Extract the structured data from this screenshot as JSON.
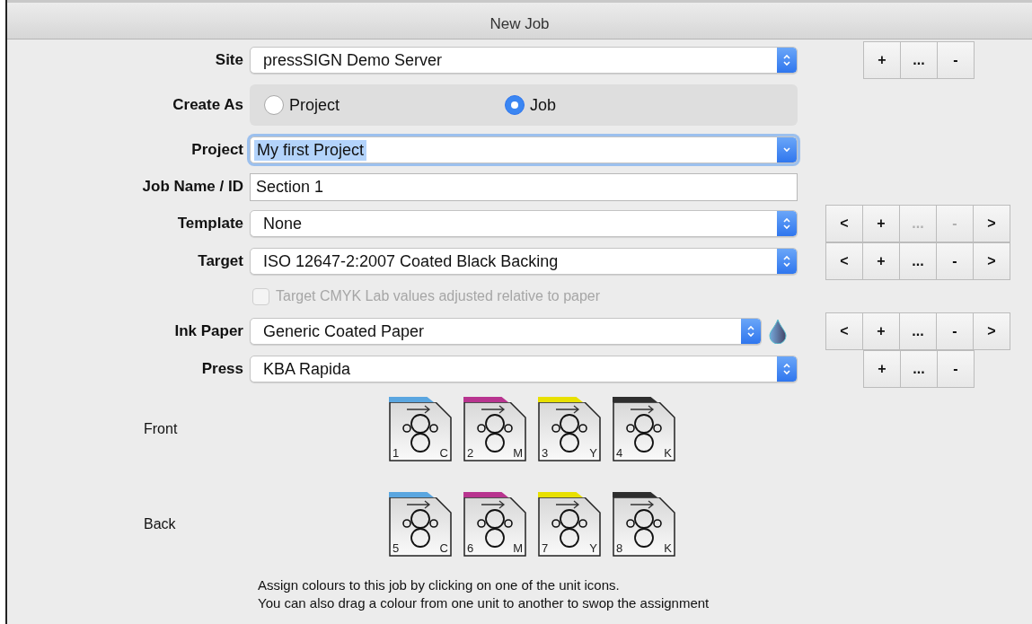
{
  "window": {
    "title": "New Job"
  },
  "form": [
    {
      "kind": "popup",
      "label": "Site",
      "value": "pressSIGN Demo Server",
      "buttons_inset": true,
      "buttons": [
        {
          "label": "+",
          "disabled": false
        },
        {
          "label": "...",
          "disabled": false
        },
        {
          "label": "-",
          "disabled": false
        }
      ]
    },
    {
      "kind": "radio",
      "label": "Create As",
      "options": [
        {
          "label": "Project",
          "selected": false
        },
        {
          "label": "Job",
          "selected": true
        }
      ]
    },
    {
      "kind": "combo",
      "label": "Project",
      "value": "My first Project",
      "focused": true
    },
    {
      "kind": "text",
      "label": "Job Name / ID",
      "value": "Section 1"
    },
    {
      "kind": "popup",
      "label": "Template",
      "value": "None",
      "buttons": [
        {
          "label": "<",
          "disabled": false
        },
        {
          "label": "+",
          "disabled": false
        },
        {
          "label": "...",
          "disabled": true
        },
        {
          "label": "-",
          "disabled": true
        },
        {
          "label": ">",
          "disabled": false
        }
      ]
    },
    {
      "kind": "popup",
      "label": "Target",
      "value": "ISO 12647-2:2007 Coated Black Backing",
      "buttons": [
        {
          "label": "<",
          "disabled": false
        },
        {
          "label": "+",
          "disabled": false
        },
        {
          "label": "...",
          "disabled": false
        },
        {
          "label": "-",
          "disabled": false
        },
        {
          "label": ">",
          "disabled": false
        }
      ]
    },
    {
      "kind": "checkbox",
      "label": "Target CMYK Lab values adjusted relative to paper",
      "checked": false,
      "disabled": true
    },
    {
      "kind": "popup",
      "label": "Ink Paper",
      "value": "Generic Coated Paper",
      "ink_drop": true,
      "buttons": [
        {
          "label": "<",
          "disabled": false
        },
        {
          "label": "+",
          "disabled": false
        },
        {
          "label": "...",
          "disabled": false
        },
        {
          "label": "-",
          "disabled": false
        },
        {
          "label": ">",
          "disabled": false
        }
      ]
    },
    {
      "kind": "popup",
      "label": "Press",
      "value": "KBA Rapida",
      "buttons_inset": true,
      "buttons": [
        {
          "label": "+",
          "disabled": false
        },
        {
          "label": "...",
          "disabled": false
        },
        {
          "label": "-",
          "disabled": false
        }
      ]
    }
  ],
  "sides": [
    {
      "label": "Front",
      "units": [
        {
          "number": "1",
          "ink": "C",
          "color": "#5aa6e0"
        },
        {
          "number": "2",
          "ink": "M",
          "color": "#b8348f"
        },
        {
          "number": "3",
          "ink": "Y",
          "color": "#e8e000"
        },
        {
          "number": "4",
          "ink": "K",
          "color": "#2e2e2e"
        }
      ]
    },
    {
      "label": "Back",
      "units": [
        {
          "number": "5",
          "ink": "C",
          "color": "#5aa6e0"
        },
        {
          "number": "6",
          "ink": "M",
          "color": "#b8348f"
        },
        {
          "number": "7",
          "ink": "Y",
          "color": "#e8e000"
        },
        {
          "number": "8",
          "ink": "K",
          "color": "#2e2e2e"
        }
      ]
    }
  ],
  "help_text": [
    "Assign colours to this job by clicking on one of the unit icons.",
    "You can also drag a colour from one unit to another to swop the assignment"
  ]
}
